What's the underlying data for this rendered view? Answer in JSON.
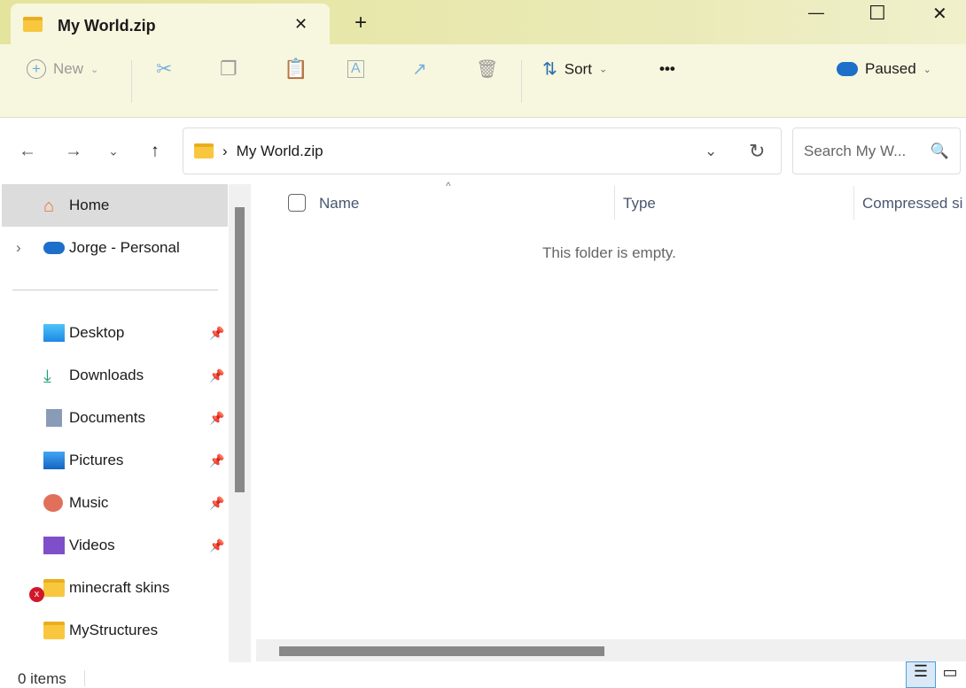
{
  "tab": {
    "title": "My World.zip",
    "close": "✕",
    "new_tab": "+"
  },
  "window": {
    "minimize": "—",
    "maximize": "☐",
    "close": "✕"
  },
  "toolbar": {
    "new_label": "New",
    "sort_label": "Sort",
    "more": "•••",
    "sync_status": "Paused"
  },
  "address": {
    "path": "My World.zip",
    "separator": "›",
    "search_placeholder": "Search My W..."
  },
  "sidebar": {
    "items": [
      {
        "label": "Home"
      },
      {
        "label": "Jorge - Personal"
      },
      {
        "label": "Desktop"
      },
      {
        "label": "Downloads"
      },
      {
        "label": "Documents"
      },
      {
        "label": "Pictures"
      },
      {
        "label": "Music"
      },
      {
        "label": "Videos"
      },
      {
        "label": "minecraft skins"
      },
      {
        "label": "MyStructures"
      }
    ]
  },
  "columns": [
    "Name",
    "Type",
    "Compressed si"
  ],
  "empty_message": "This folder is empty.",
  "status": {
    "items": "0 items"
  }
}
